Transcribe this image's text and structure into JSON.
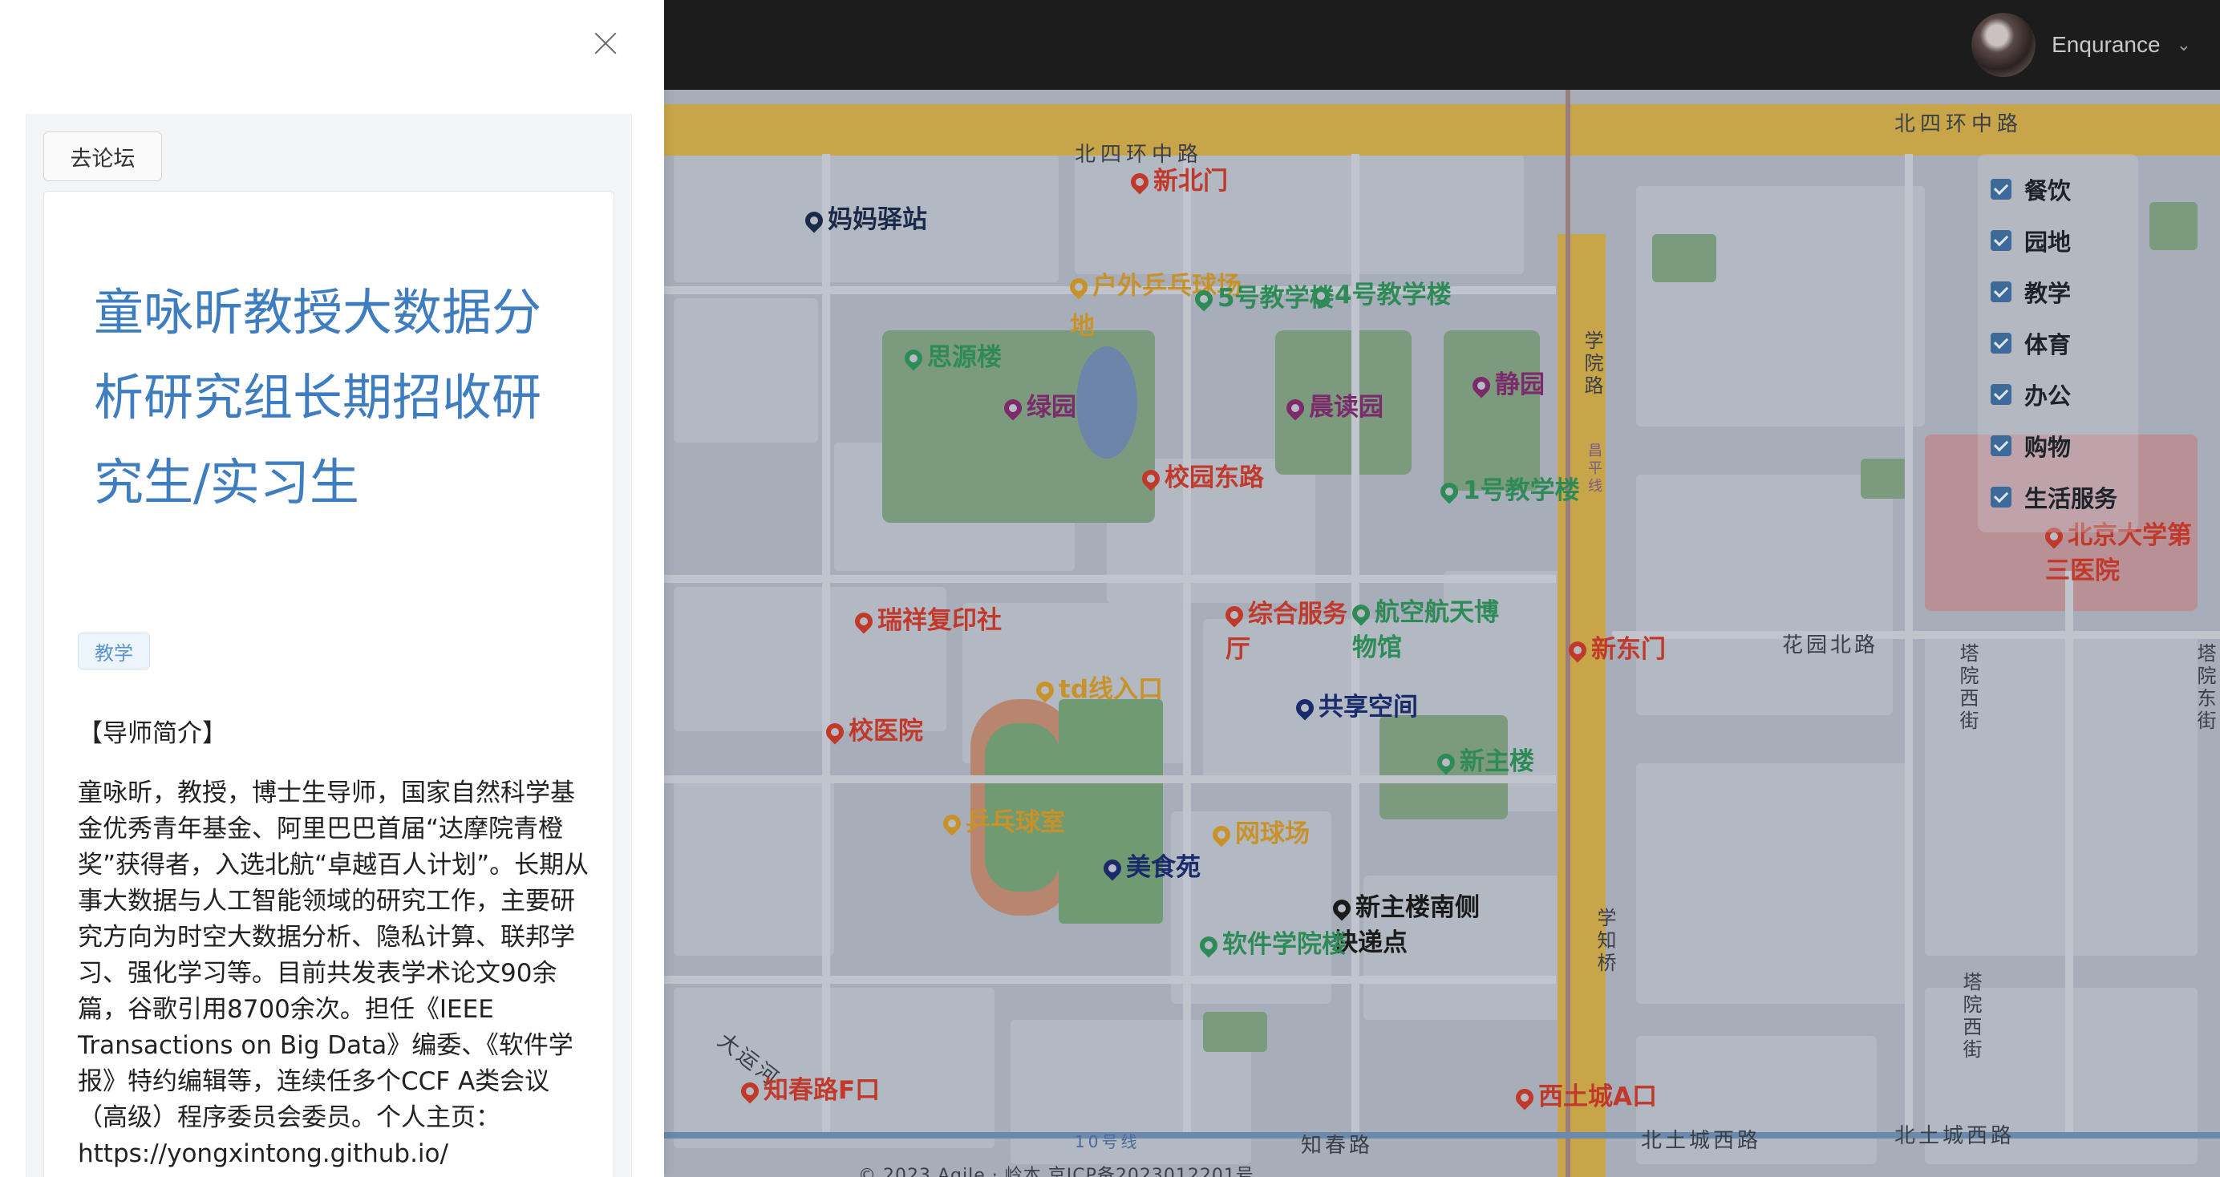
{
  "header": {
    "username": "Enqurance"
  },
  "map": {
    "road_labels": {
      "north_4th_ring_left": "北四环中路",
      "north_4th_ring_right": "北四环中路",
      "xueyuan_road": "学院路",
      "huayuan_north_road": "花园北路",
      "zhichun_road": "知春路",
      "north_tucheng_west_1": "北土城西路",
      "north_tucheng_west_2": "北土城西路",
      "xuezhi_bridge": "学知桥",
      "tayuan_west_st_1": "塔院西街",
      "tayuan_west_st_2": "塔院西街",
      "tayuan_east_st": "塔院东街",
      "da_yun_he": "大运河",
      "line10": "10号线",
      "changping_line": "昌平线"
    },
    "footer": "© 2023 Agile   · 岭本 京ICP备2023012201号",
    "pois": [
      {
        "name": "妈妈驿站",
        "color": "#1a2a4a"
      },
      {
        "name": "新北门",
        "color": "#c0392b"
      },
      {
        "name": "户外乒乓球场地",
        "color": "#c8922a"
      },
      {
        "name": "5号教学楼",
        "color": "#2e8b57"
      },
      {
        "name": "4号教学楼",
        "color": "#2e8b57"
      },
      {
        "name": "思源楼",
        "color": "#2e8b57"
      },
      {
        "name": "绿园",
        "color": "#7b2a6b"
      },
      {
        "name": "晨读园",
        "color": "#7b2a6b"
      },
      {
        "name": "静园",
        "color": "#7b2a6b"
      },
      {
        "name": "校园东路",
        "color": "#c0392b"
      },
      {
        "name": "1号教学楼",
        "color": "#2e8b57"
      },
      {
        "name": "北京大学第三医院",
        "color": "#c0392b"
      },
      {
        "name": "瑞祥复印社",
        "color": "#c0392b"
      },
      {
        "name": "综合服务厅",
        "color": "#c0392b"
      },
      {
        "name": "航空航天博物馆",
        "color": "#2e8b57"
      },
      {
        "name": "新东门",
        "color": "#c0392b"
      },
      {
        "name": "td线入口",
        "color": "#c8922a"
      },
      {
        "name": "共享空间",
        "color": "#1a2a6a"
      },
      {
        "name": "校医院",
        "color": "#c0392b"
      },
      {
        "name": "新主楼",
        "color": "#2e8b57"
      },
      {
        "name": "乒乓球室",
        "color": "#c8922a"
      },
      {
        "name": "网球场",
        "color": "#c8922a"
      },
      {
        "name": "美食苑",
        "color": "#1a2a6a"
      },
      {
        "name": "新主楼南侧快递点",
        "color": "#1a1a1a"
      },
      {
        "name": "软件学院楼",
        "color": "#2e8b57"
      },
      {
        "name": "知春路F口",
        "color": "#c0392b"
      },
      {
        "name": "西土城A口",
        "color": "#c0392b"
      }
    ]
  },
  "filters": {
    "items": [
      {
        "label": "餐饮",
        "checked": true
      },
      {
        "label": "园地",
        "checked": true
      },
      {
        "label": "教学",
        "checked": true
      },
      {
        "label": "体育",
        "checked": true
      },
      {
        "label": "办公",
        "checked": true
      },
      {
        "label": "购物",
        "checked": true
      },
      {
        "label": "生活服务",
        "checked": true
      }
    ],
    "check_color": "#3d6a99"
  },
  "drawer": {
    "forum_button": "去论坛",
    "post": {
      "title": "童咏昕教授大数据分析研究组长期招收研究生/实习生",
      "tag": "教学",
      "section_heading": "【导师简介】",
      "body": "童咏昕，教授，博士生导师，国家自然科学基金优秀青年基金、阿里巴巴首届“达摩院青橙奖”获得者，入选北航“卓越百人计划”。长期从事大数据与人工智能领域的研究工作，主要研究方向为时空大数据分析、隐私计算、联邦学习、强化学习等。目前共发表学术论文90余篇，谷歌引用8700余次。担任《IEEE Transactions on Big Data》编委、《软件学报》特约编辑等，连续任多个CCF A类会议（高级）程序委员会委员。个人主页：https://yongxintong.github.io/"
    },
    "title_color": "#3d7dc0"
  }
}
